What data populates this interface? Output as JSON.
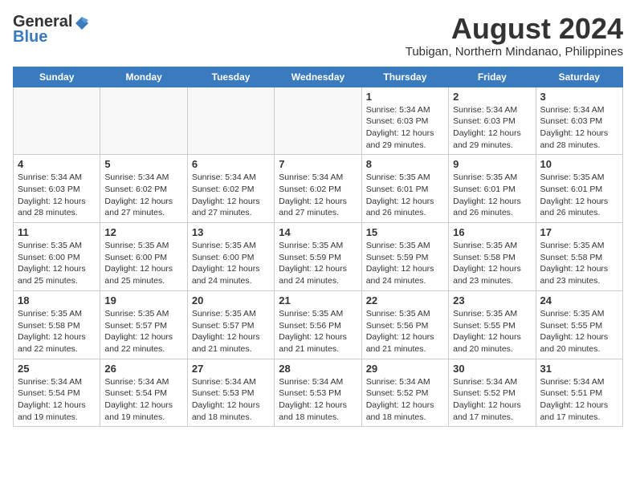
{
  "header": {
    "logo_general": "General",
    "logo_blue": "Blue",
    "title": "August 2024",
    "subtitle": "Tubigan, Northern Mindanao, Philippines"
  },
  "calendar": {
    "days_of_week": [
      "Sunday",
      "Monday",
      "Tuesday",
      "Wednesday",
      "Thursday",
      "Friday",
      "Saturday"
    ],
    "weeks": [
      [
        {
          "day": "",
          "content": ""
        },
        {
          "day": "",
          "content": ""
        },
        {
          "day": "",
          "content": ""
        },
        {
          "day": "",
          "content": ""
        },
        {
          "day": "1",
          "content": "Sunrise: 5:34 AM\nSunset: 6:03 PM\nDaylight: 12 hours\nand 29 minutes."
        },
        {
          "day": "2",
          "content": "Sunrise: 5:34 AM\nSunset: 6:03 PM\nDaylight: 12 hours\nand 29 minutes."
        },
        {
          "day": "3",
          "content": "Sunrise: 5:34 AM\nSunset: 6:03 PM\nDaylight: 12 hours\nand 28 minutes."
        }
      ],
      [
        {
          "day": "4",
          "content": "Sunrise: 5:34 AM\nSunset: 6:03 PM\nDaylight: 12 hours\nand 28 minutes."
        },
        {
          "day": "5",
          "content": "Sunrise: 5:34 AM\nSunset: 6:02 PM\nDaylight: 12 hours\nand 27 minutes."
        },
        {
          "day": "6",
          "content": "Sunrise: 5:34 AM\nSunset: 6:02 PM\nDaylight: 12 hours\nand 27 minutes."
        },
        {
          "day": "7",
          "content": "Sunrise: 5:34 AM\nSunset: 6:02 PM\nDaylight: 12 hours\nand 27 minutes."
        },
        {
          "day": "8",
          "content": "Sunrise: 5:35 AM\nSunset: 6:01 PM\nDaylight: 12 hours\nand 26 minutes."
        },
        {
          "day": "9",
          "content": "Sunrise: 5:35 AM\nSunset: 6:01 PM\nDaylight: 12 hours\nand 26 minutes."
        },
        {
          "day": "10",
          "content": "Sunrise: 5:35 AM\nSunset: 6:01 PM\nDaylight: 12 hours\nand 26 minutes."
        }
      ],
      [
        {
          "day": "11",
          "content": "Sunrise: 5:35 AM\nSunset: 6:00 PM\nDaylight: 12 hours\nand 25 minutes."
        },
        {
          "day": "12",
          "content": "Sunrise: 5:35 AM\nSunset: 6:00 PM\nDaylight: 12 hours\nand 25 minutes."
        },
        {
          "day": "13",
          "content": "Sunrise: 5:35 AM\nSunset: 6:00 PM\nDaylight: 12 hours\nand 24 minutes."
        },
        {
          "day": "14",
          "content": "Sunrise: 5:35 AM\nSunset: 5:59 PM\nDaylight: 12 hours\nand 24 minutes."
        },
        {
          "day": "15",
          "content": "Sunrise: 5:35 AM\nSunset: 5:59 PM\nDaylight: 12 hours\nand 24 minutes."
        },
        {
          "day": "16",
          "content": "Sunrise: 5:35 AM\nSunset: 5:58 PM\nDaylight: 12 hours\nand 23 minutes."
        },
        {
          "day": "17",
          "content": "Sunrise: 5:35 AM\nSunset: 5:58 PM\nDaylight: 12 hours\nand 23 minutes."
        }
      ],
      [
        {
          "day": "18",
          "content": "Sunrise: 5:35 AM\nSunset: 5:58 PM\nDaylight: 12 hours\nand 22 minutes."
        },
        {
          "day": "19",
          "content": "Sunrise: 5:35 AM\nSunset: 5:57 PM\nDaylight: 12 hours\nand 22 minutes."
        },
        {
          "day": "20",
          "content": "Sunrise: 5:35 AM\nSunset: 5:57 PM\nDaylight: 12 hours\nand 21 minutes."
        },
        {
          "day": "21",
          "content": "Sunrise: 5:35 AM\nSunset: 5:56 PM\nDaylight: 12 hours\nand 21 minutes."
        },
        {
          "day": "22",
          "content": "Sunrise: 5:35 AM\nSunset: 5:56 PM\nDaylight: 12 hours\nand 21 minutes."
        },
        {
          "day": "23",
          "content": "Sunrise: 5:35 AM\nSunset: 5:55 PM\nDaylight: 12 hours\nand 20 minutes."
        },
        {
          "day": "24",
          "content": "Sunrise: 5:35 AM\nSunset: 5:55 PM\nDaylight: 12 hours\nand 20 minutes."
        }
      ],
      [
        {
          "day": "25",
          "content": "Sunrise: 5:34 AM\nSunset: 5:54 PM\nDaylight: 12 hours\nand 19 minutes."
        },
        {
          "day": "26",
          "content": "Sunrise: 5:34 AM\nSunset: 5:54 PM\nDaylight: 12 hours\nand 19 minutes."
        },
        {
          "day": "27",
          "content": "Sunrise: 5:34 AM\nSunset: 5:53 PM\nDaylight: 12 hours\nand 18 minutes."
        },
        {
          "day": "28",
          "content": "Sunrise: 5:34 AM\nSunset: 5:53 PM\nDaylight: 12 hours\nand 18 minutes."
        },
        {
          "day": "29",
          "content": "Sunrise: 5:34 AM\nSunset: 5:52 PM\nDaylight: 12 hours\nand 18 minutes."
        },
        {
          "day": "30",
          "content": "Sunrise: 5:34 AM\nSunset: 5:52 PM\nDaylight: 12 hours\nand 17 minutes."
        },
        {
          "day": "31",
          "content": "Sunrise: 5:34 AM\nSunset: 5:51 PM\nDaylight: 12 hours\nand 17 minutes."
        }
      ]
    ]
  }
}
